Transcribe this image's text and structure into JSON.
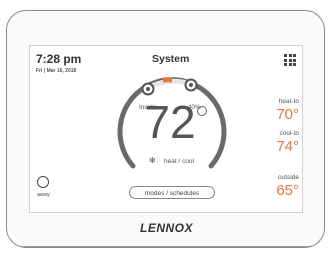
{
  "status": {
    "time": "7:28 pm",
    "date": "Fri | Mar 16, 2018",
    "title": "System"
  },
  "indoor": {
    "inside_label": "Inside",
    "humidity": "40%",
    "temperature": "72",
    "mode": "heat / cool"
  },
  "setpoints": {
    "heat_label": "heat-to",
    "heat_value": "70°",
    "cool_label": "cool-to",
    "cool_value": "74°"
  },
  "outdoor": {
    "label": "outside",
    "value": "65°"
  },
  "controls": {
    "modes_label": "modes / schedules",
    "away_label": "away"
  },
  "brand": {
    "logo_text": "LENNOX"
  },
  "colors": {
    "setpoint": "#e57540",
    "arc": "#6a6a6a"
  },
  "icons": [
    "menu-grid-icon",
    "humidity-drop-icon",
    "away-icon",
    "fan-icon"
  ]
}
